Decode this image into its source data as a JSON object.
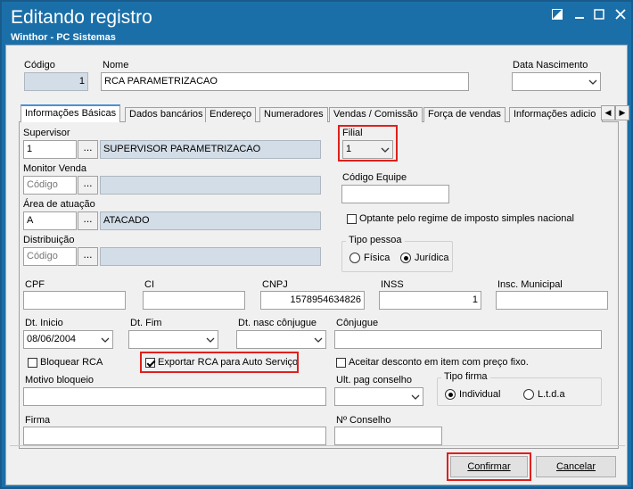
{
  "window": {
    "title": "Editando registro",
    "subtitle": "Winthor - PC Sistemas",
    "titlebar_color": "#1b6fa8",
    "highlight_color": "#e0201c"
  },
  "header": {
    "codigo_label": "Código",
    "codigo_value": "1",
    "nome_label": "Nome",
    "nome_value": "RCA PARAMETRIZACAO",
    "data_nascimento_label": "Data Nascimento",
    "data_nascimento_value": ""
  },
  "tabs": [
    {
      "label": "Informações Básicas",
      "active": true
    },
    {
      "label": "Dados bancários"
    },
    {
      "label": "Endereço"
    },
    {
      "label": "Numeradores"
    },
    {
      "label": "Vendas  / Comissão"
    },
    {
      "label": "Força de vendas"
    },
    {
      "label": "Informações adicio"
    }
  ],
  "basic": {
    "supervisor_label": "Supervisor",
    "supervisor_code": "1",
    "supervisor_name": "SUPERVISOR PARAMETRIZACAO",
    "monitor_label": "Monitor Venda",
    "monitor_placeholder": "Código",
    "area_label": "Área de atuação",
    "area_code": "A",
    "area_name": "ATACADO",
    "distribuicao_label": "Distribuição",
    "distribuicao_placeholder": "Código",
    "dots": "...",
    "filial_label": "Filial",
    "filial_value": "1",
    "codigo_equipe_label": "Código Equipe",
    "optante_label": "Optante pelo regime de imposto simples nacional",
    "tipo_pessoa_label": "Tipo pessoa",
    "fisica_label": "Física",
    "juridica_label": "Jurídica",
    "cpf_label": "CPF",
    "ci_label": "CI",
    "cnpj_label": "CNPJ",
    "cnpj_value": "1578954634826",
    "inss_label": "INSS",
    "inss_value": "1",
    "insc_municipal_label": "Insc. Municipal",
    "dt_inicio_label": "Dt. Inicio",
    "dt_inicio_value": "08/06/2004",
    "dt_fim_label": "Dt. Fim",
    "dt_nasc_conjugue_label": "Dt. nasc cônjugue",
    "conjugue_label": "Cônjugue",
    "bloquear_label": "Bloquear RCA",
    "exportar_label": "Exportar RCA para Auto Serviço",
    "aceitar_label": "Aceitar desconto em item com preço fixo.",
    "motivo_label": "Motivo bloqueio",
    "ult_pag_label": "Ult. pag conselho",
    "tipo_firma_label": "Tipo firma",
    "individual_label": "Individual",
    "ltda_label": "L.t.d.a",
    "firma_label": "Firma",
    "n_conselho_label": "Nº Conselho"
  },
  "footer": {
    "confirmar_label": "Confirmar",
    "cancelar_label": "Cancelar"
  }
}
